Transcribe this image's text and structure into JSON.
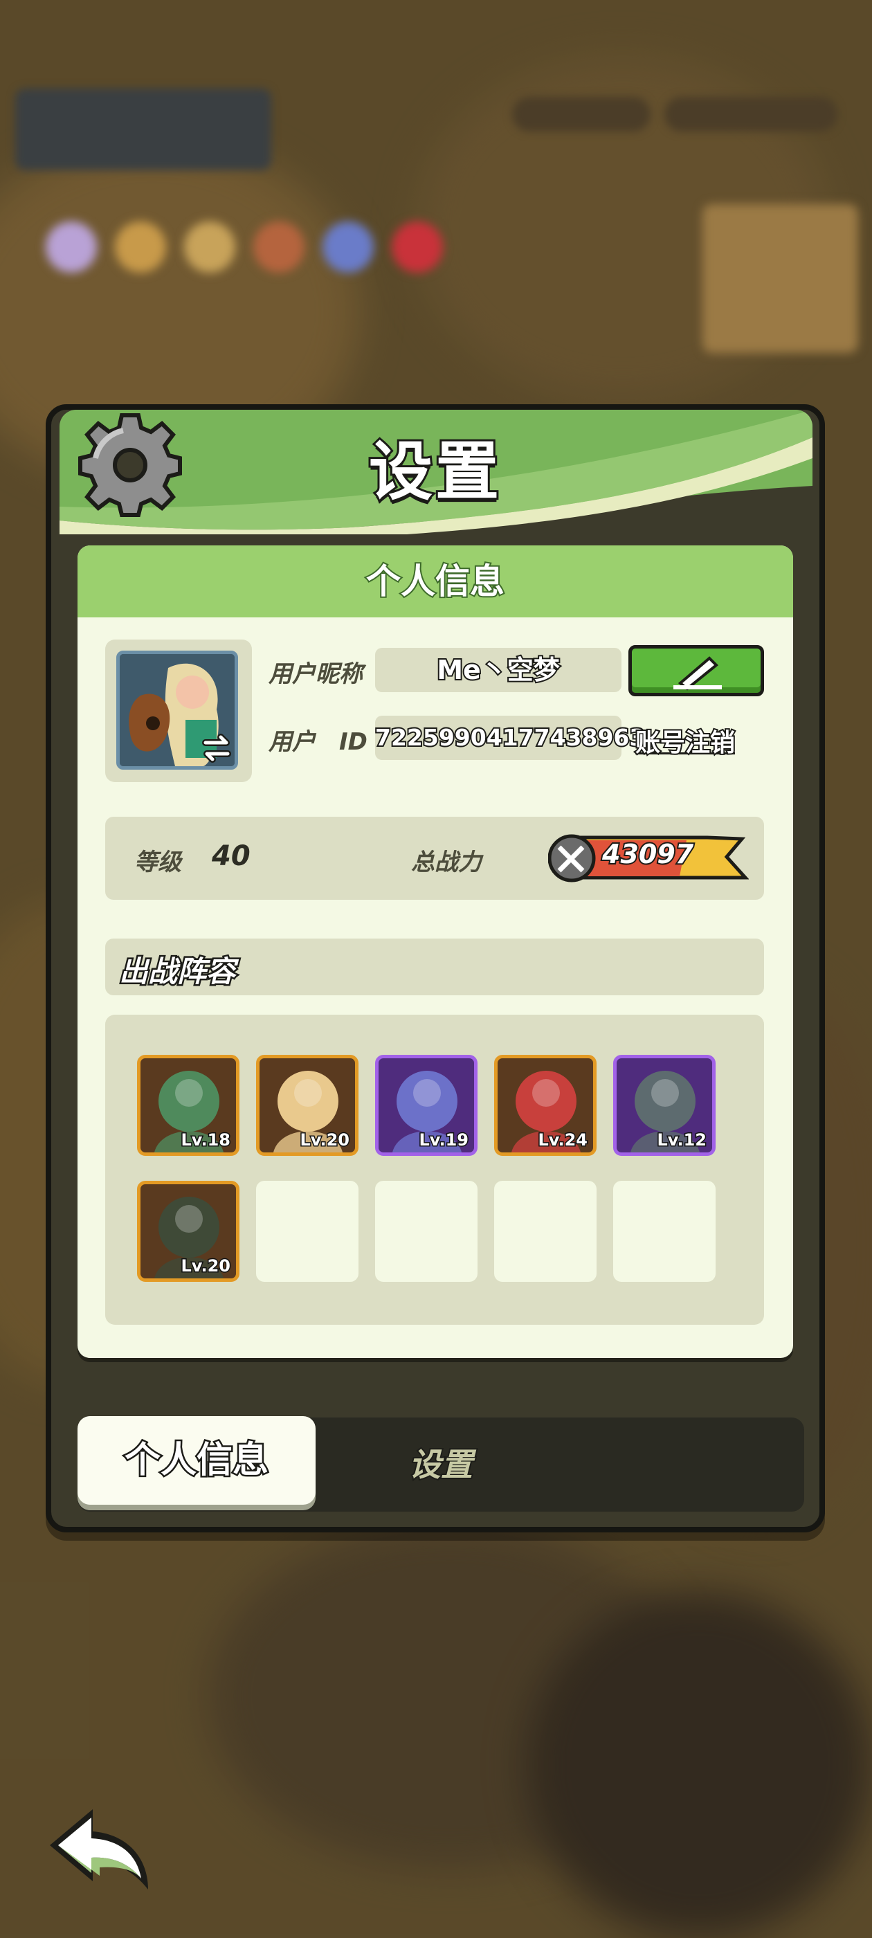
{
  "panel": {
    "title": "设置",
    "section_header": "个人信息"
  },
  "profile": {
    "nickname_label": "用户昵称",
    "nickname": "Me丶空梦",
    "id_label": "用户　ID",
    "user_id": "72259904177438963",
    "logout_label": "账号注销"
  },
  "stats": {
    "level_label": "等级",
    "level": "40",
    "power_label": "总战力",
    "power": "43097"
  },
  "lineup": {
    "title": "出战阵容",
    "heroes": [
      {
        "level": "Lv.18",
        "rarity": "legendary",
        "color": "#4f8a5c"
      },
      {
        "level": "Lv.20",
        "rarity": "legendary",
        "color": "#e9c98d"
      },
      {
        "level": "Lv.19",
        "rarity": "epic",
        "color": "#6c71c9"
      },
      {
        "level": "Lv.24",
        "rarity": "legendary",
        "color": "#c8403c"
      },
      {
        "level": "Lv.12",
        "rarity": "epic",
        "color": "#5d6b6f"
      },
      {
        "level": "Lv.20",
        "rarity": "legendary",
        "color": "#3f4a37"
      }
    ],
    "empty_slots": 4
  },
  "tabs": {
    "active": "个人信息",
    "inactive": "设置"
  },
  "colors": {
    "header_green": "#9bd06e",
    "button_green": "#5db83c",
    "legendary_border": "#e39a25",
    "epic_border": "#a262e8"
  }
}
